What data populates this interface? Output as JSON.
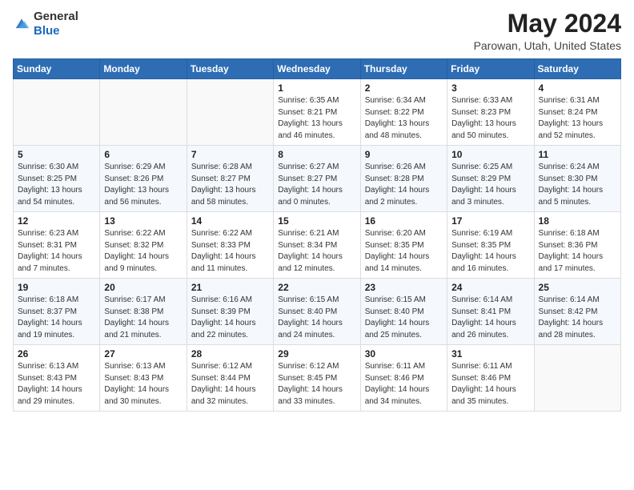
{
  "header": {
    "logo_line1": "General",
    "logo_line2": "Blue",
    "main_title": "May 2024",
    "subtitle": "Parowan, Utah, United States"
  },
  "weekdays": [
    "Sunday",
    "Monday",
    "Tuesday",
    "Wednesday",
    "Thursday",
    "Friday",
    "Saturday"
  ],
  "weeks": [
    [
      {
        "day": "",
        "sunrise": "",
        "sunset": "",
        "daylight": ""
      },
      {
        "day": "",
        "sunrise": "",
        "sunset": "",
        "daylight": ""
      },
      {
        "day": "",
        "sunrise": "",
        "sunset": "",
        "daylight": ""
      },
      {
        "day": "1",
        "sunrise": "Sunrise: 6:35 AM",
        "sunset": "Sunset: 8:21 PM",
        "daylight": "Daylight: 13 hours and 46 minutes."
      },
      {
        "day": "2",
        "sunrise": "Sunrise: 6:34 AM",
        "sunset": "Sunset: 8:22 PM",
        "daylight": "Daylight: 13 hours and 48 minutes."
      },
      {
        "day": "3",
        "sunrise": "Sunrise: 6:33 AM",
        "sunset": "Sunset: 8:23 PM",
        "daylight": "Daylight: 13 hours and 50 minutes."
      },
      {
        "day": "4",
        "sunrise": "Sunrise: 6:31 AM",
        "sunset": "Sunset: 8:24 PM",
        "daylight": "Daylight: 13 hours and 52 minutes."
      }
    ],
    [
      {
        "day": "5",
        "sunrise": "Sunrise: 6:30 AM",
        "sunset": "Sunset: 8:25 PM",
        "daylight": "Daylight: 13 hours and 54 minutes."
      },
      {
        "day": "6",
        "sunrise": "Sunrise: 6:29 AM",
        "sunset": "Sunset: 8:26 PM",
        "daylight": "Daylight: 13 hours and 56 minutes."
      },
      {
        "day": "7",
        "sunrise": "Sunrise: 6:28 AM",
        "sunset": "Sunset: 8:27 PM",
        "daylight": "Daylight: 13 hours and 58 minutes."
      },
      {
        "day": "8",
        "sunrise": "Sunrise: 6:27 AM",
        "sunset": "Sunset: 8:27 PM",
        "daylight": "Daylight: 14 hours and 0 minutes."
      },
      {
        "day": "9",
        "sunrise": "Sunrise: 6:26 AM",
        "sunset": "Sunset: 8:28 PM",
        "daylight": "Daylight: 14 hours and 2 minutes."
      },
      {
        "day": "10",
        "sunrise": "Sunrise: 6:25 AM",
        "sunset": "Sunset: 8:29 PM",
        "daylight": "Daylight: 14 hours and 3 minutes."
      },
      {
        "day": "11",
        "sunrise": "Sunrise: 6:24 AM",
        "sunset": "Sunset: 8:30 PM",
        "daylight": "Daylight: 14 hours and 5 minutes."
      }
    ],
    [
      {
        "day": "12",
        "sunrise": "Sunrise: 6:23 AM",
        "sunset": "Sunset: 8:31 PM",
        "daylight": "Daylight: 14 hours and 7 minutes."
      },
      {
        "day": "13",
        "sunrise": "Sunrise: 6:22 AM",
        "sunset": "Sunset: 8:32 PM",
        "daylight": "Daylight: 14 hours and 9 minutes."
      },
      {
        "day": "14",
        "sunrise": "Sunrise: 6:22 AM",
        "sunset": "Sunset: 8:33 PM",
        "daylight": "Daylight: 14 hours and 11 minutes."
      },
      {
        "day": "15",
        "sunrise": "Sunrise: 6:21 AM",
        "sunset": "Sunset: 8:34 PM",
        "daylight": "Daylight: 14 hours and 12 minutes."
      },
      {
        "day": "16",
        "sunrise": "Sunrise: 6:20 AM",
        "sunset": "Sunset: 8:35 PM",
        "daylight": "Daylight: 14 hours and 14 minutes."
      },
      {
        "day": "17",
        "sunrise": "Sunrise: 6:19 AM",
        "sunset": "Sunset: 8:35 PM",
        "daylight": "Daylight: 14 hours and 16 minutes."
      },
      {
        "day": "18",
        "sunrise": "Sunrise: 6:18 AM",
        "sunset": "Sunset: 8:36 PM",
        "daylight": "Daylight: 14 hours and 17 minutes."
      }
    ],
    [
      {
        "day": "19",
        "sunrise": "Sunrise: 6:18 AM",
        "sunset": "Sunset: 8:37 PM",
        "daylight": "Daylight: 14 hours and 19 minutes."
      },
      {
        "day": "20",
        "sunrise": "Sunrise: 6:17 AM",
        "sunset": "Sunset: 8:38 PM",
        "daylight": "Daylight: 14 hours and 21 minutes."
      },
      {
        "day": "21",
        "sunrise": "Sunrise: 6:16 AM",
        "sunset": "Sunset: 8:39 PM",
        "daylight": "Daylight: 14 hours and 22 minutes."
      },
      {
        "day": "22",
        "sunrise": "Sunrise: 6:15 AM",
        "sunset": "Sunset: 8:40 PM",
        "daylight": "Daylight: 14 hours and 24 minutes."
      },
      {
        "day": "23",
        "sunrise": "Sunrise: 6:15 AM",
        "sunset": "Sunset: 8:40 PM",
        "daylight": "Daylight: 14 hours and 25 minutes."
      },
      {
        "day": "24",
        "sunrise": "Sunrise: 6:14 AM",
        "sunset": "Sunset: 8:41 PM",
        "daylight": "Daylight: 14 hours and 26 minutes."
      },
      {
        "day": "25",
        "sunrise": "Sunrise: 6:14 AM",
        "sunset": "Sunset: 8:42 PM",
        "daylight": "Daylight: 14 hours and 28 minutes."
      }
    ],
    [
      {
        "day": "26",
        "sunrise": "Sunrise: 6:13 AM",
        "sunset": "Sunset: 8:43 PM",
        "daylight": "Daylight: 14 hours and 29 minutes."
      },
      {
        "day": "27",
        "sunrise": "Sunrise: 6:13 AM",
        "sunset": "Sunset: 8:43 PM",
        "daylight": "Daylight: 14 hours and 30 minutes."
      },
      {
        "day": "28",
        "sunrise": "Sunrise: 6:12 AM",
        "sunset": "Sunset: 8:44 PM",
        "daylight": "Daylight: 14 hours and 32 minutes."
      },
      {
        "day": "29",
        "sunrise": "Sunrise: 6:12 AM",
        "sunset": "Sunset: 8:45 PM",
        "daylight": "Daylight: 14 hours and 33 minutes."
      },
      {
        "day": "30",
        "sunrise": "Sunrise: 6:11 AM",
        "sunset": "Sunset: 8:46 PM",
        "daylight": "Daylight: 14 hours and 34 minutes."
      },
      {
        "day": "31",
        "sunrise": "Sunrise: 6:11 AM",
        "sunset": "Sunset: 8:46 PM",
        "daylight": "Daylight: 14 hours and 35 minutes."
      },
      {
        "day": "",
        "sunrise": "",
        "sunset": "",
        "daylight": ""
      }
    ]
  ]
}
